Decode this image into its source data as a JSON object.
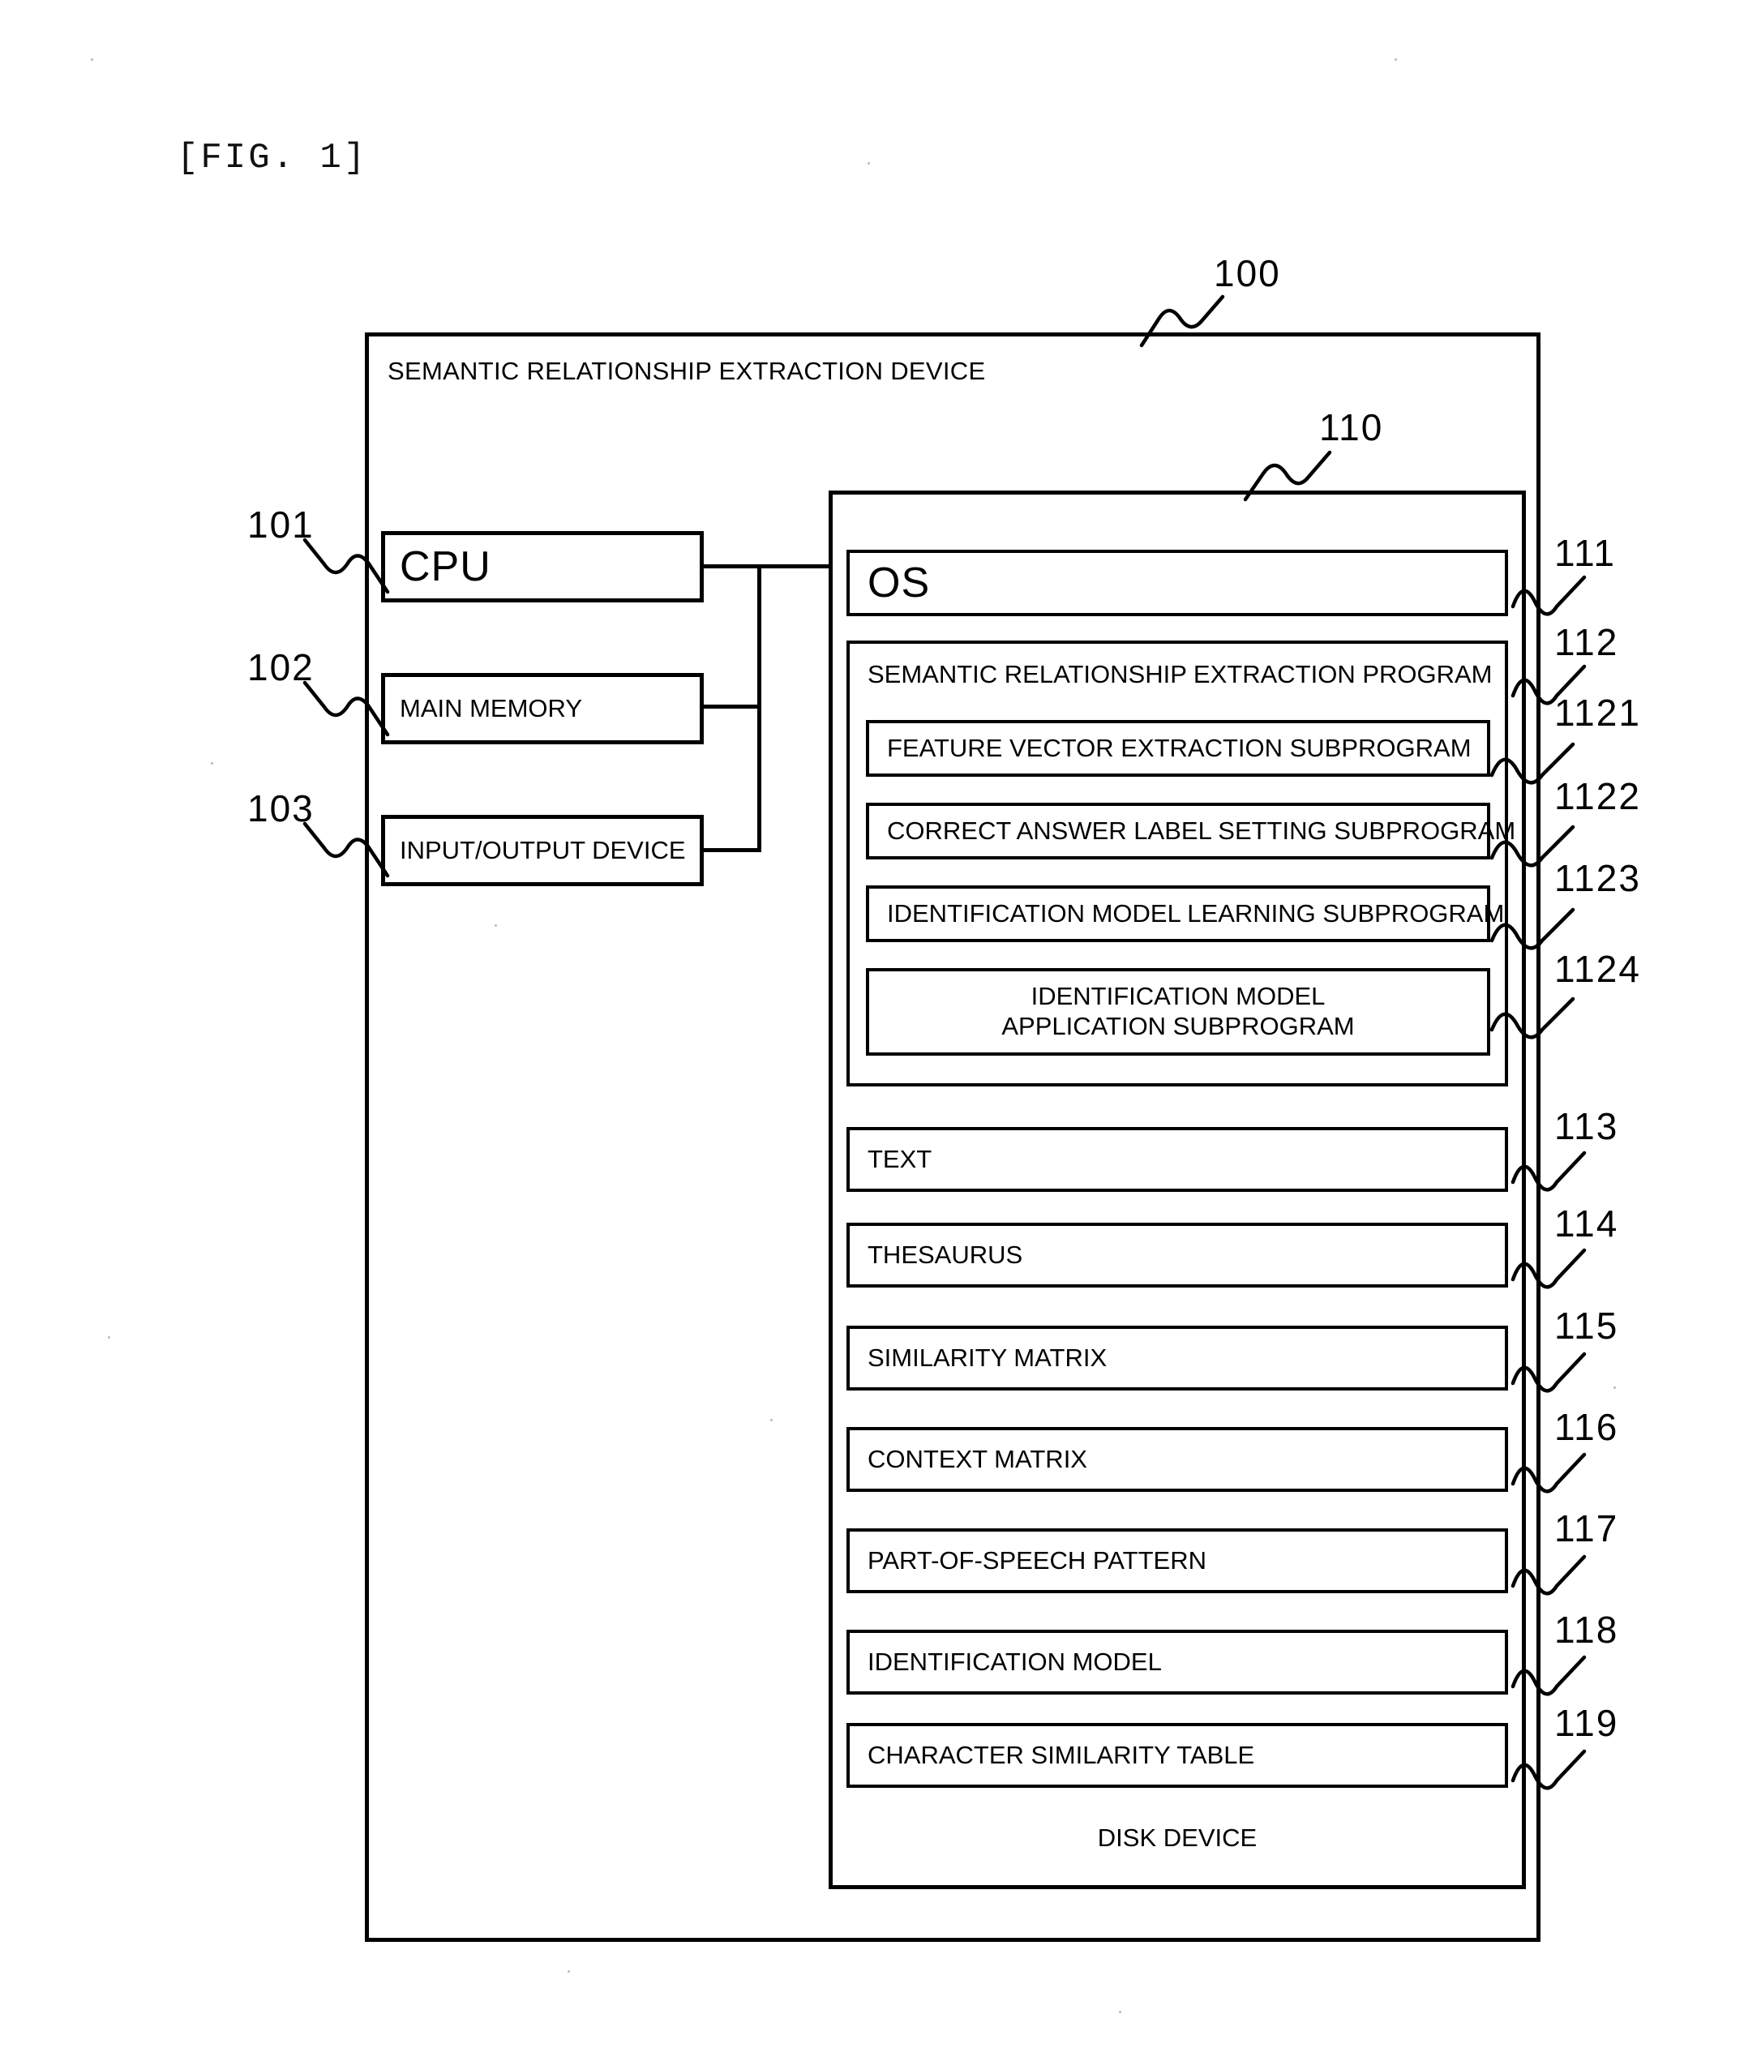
{
  "figure": {
    "caption": "[FIG. 1]"
  },
  "device": {
    "title": "SEMANTIC RELATIONSHIP EXTRACTION DEVICE",
    "ref": "100"
  },
  "hardware": [
    {
      "label": "CPU",
      "ref": "101"
    },
    {
      "label": "MAIN MEMORY",
      "ref": "102"
    },
    {
      "label": "INPUT/OUTPUT DEVICE",
      "ref": "103"
    }
  ],
  "disk": {
    "caption": "DISK DEVICE",
    "ref": "110"
  },
  "os": {
    "label": "OS",
    "ref": "111"
  },
  "program": {
    "label": "SEMANTIC RELATIONSHIP EXTRACTION PROGRAM",
    "ref": "112",
    "subprograms": [
      {
        "label": "FEATURE VECTOR EXTRACTION SUBPROGRAM",
        "ref": "1121"
      },
      {
        "label": "CORRECT ANSWER LABEL SETTING SUBPROGRAM",
        "ref": "1122"
      },
      {
        "label": "IDENTIFICATION MODEL LEARNING SUBPROGRAM",
        "ref": "1123"
      },
      {
        "label_line1": "IDENTIFICATION MODEL",
        "label_line2": "APPLICATION SUBPROGRAM",
        "ref": "1124"
      }
    ]
  },
  "data_stores": [
    {
      "label": "TEXT",
      "ref": "113"
    },
    {
      "label": "THESAURUS",
      "ref": "114"
    },
    {
      "label": "SIMILARITY MATRIX",
      "ref": "115"
    },
    {
      "label": "CONTEXT MATRIX",
      "ref": "116"
    },
    {
      "label": "PART-OF-SPEECH PATTERN",
      "ref": "117"
    },
    {
      "label": "IDENTIFICATION MODEL",
      "ref": "118"
    },
    {
      "label": "CHARACTER SIMILARITY TABLE",
      "ref": "119"
    }
  ],
  "colors": {
    "ink": "#000000",
    "paper": "#ffffff"
  }
}
